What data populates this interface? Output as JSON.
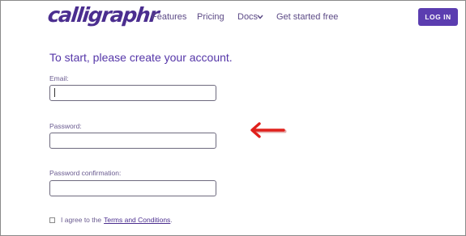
{
  "header": {
    "logo_text": "calligraphr",
    "nav": {
      "features": "Features",
      "pricing": "Pricing",
      "docs": "Docs",
      "get_started": "Get started free"
    },
    "login_label": "LOG IN"
  },
  "form": {
    "title": "To start, please create your account.",
    "email_label": "Email:",
    "email_value": "",
    "password_label": "Password:",
    "password_value": "",
    "confirm_label": "Password confirmation:",
    "confirm_value": "",
    "agree_prefix": "I agree to the",
    "terms_link": "Terms and Conditions",
    "agree_suffix": ".",
    "agree_checked": false
  },
  "annotation": {
    "arrow_color": "#e0201c",
    "arrow_icon": "left-arrow-icon"
  },
  "colors": {
    "brand": "#4b2e8f",
    "button": "#5b3db0"
  }
}
